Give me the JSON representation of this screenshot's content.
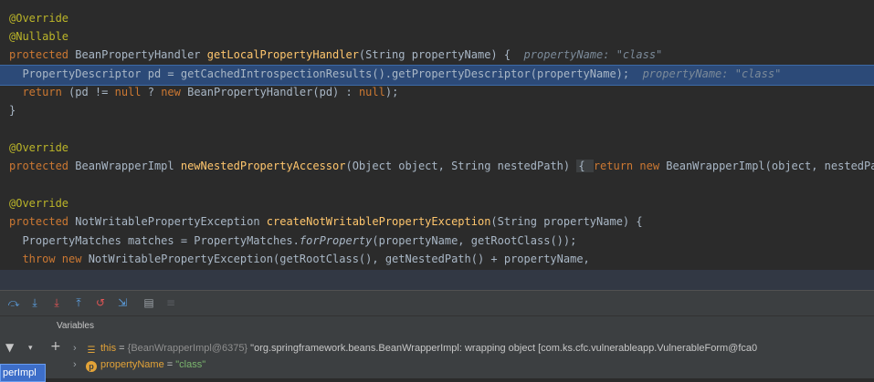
{
  "editor": {
    "line1": "@Override",
    "line2": "@Nullable",
    "line3_kw": "protected",
    "line3_type": " BeanPropertyHandler ",
    "line3_fn": "getLocalPropertyHandler",
    "line3_rest": "(String propertyName) {",
    "line3_hint": "propertyName: \"class\"",
    "line4_code": "  PropertyDescriptor pd = getCachedIntrospectionResults().getPropertyDescriptor(propertyName);",
    "line4_hint": "propertyName: \"class\"",
    "line5_kw1": "  return",
    "line5_a": " (pd != ",
    "line5_kw2": "null",
    "line5_b": " ? ",
    "line5_kw3": "new",
    "line5_c": " BeanPropertyHandler(pd) : ",
    "line5_kw4": "null",
    "line5_d": ");",
    "line6": "}",
    "line8": "@Override",
    "line9_kw": "protected",
    "line9_type": " BeanWrapperImpl ",
    "line9_fn": "newNestedPropertyAccessor",
    "line9_rest": "(Object object, String nestedPath) ",
    "line9_fold": "{ ",
    "line9_kw2": "return new",
    "line9_tail": " BeanWrapperImpl(object, nestedPat",
    "line11": "@Override",
    "line12_kw": "protected",
    "line12_type": " NotWritablePropertyException ",
    "line12_fn": "createNotWritablePropertyException",
    "line12_rest": "(String propertyName) {",
    "line13_a": "  PropertyMatches matches = PropertyMatches.",
    "line13_it": "forProperty",
    "line13_b": "(propertyName, getRootClass());",
    "line14_kw": "  throw new",
    "line14_rest": " NotWritablePropertyException(getRootClass(), getNestedPath() + propertyName,"
  },
  "toolbar": {
    "icons": [
      "step-over-icon",
      "step-into-icon",
      "force-step-into-icon",
      "step-out-icon",
      "drop-frame-icon",
      "run-to-cursor-icon",
      "evaluate-icon",
      "trace-icon"
    ]
  },
  "variables": {
    "title": "Variables",
    "frame_tab": "perImpl",
    "row1": {
      "name": "this",
      "eq": " = ",
      "type": "{BeanWrapperImpl@6375}",
      "value": " \"org.springframework.beans.BeanWrapperImpl: wrapping object [com.ks.cfc.vulnerableapp.VulnerableForm@fca0"
    },
    "row2": {
      "name": "propertyName",
      "eq": " = ",
      "value": "\"class\""
    }
  }
}
